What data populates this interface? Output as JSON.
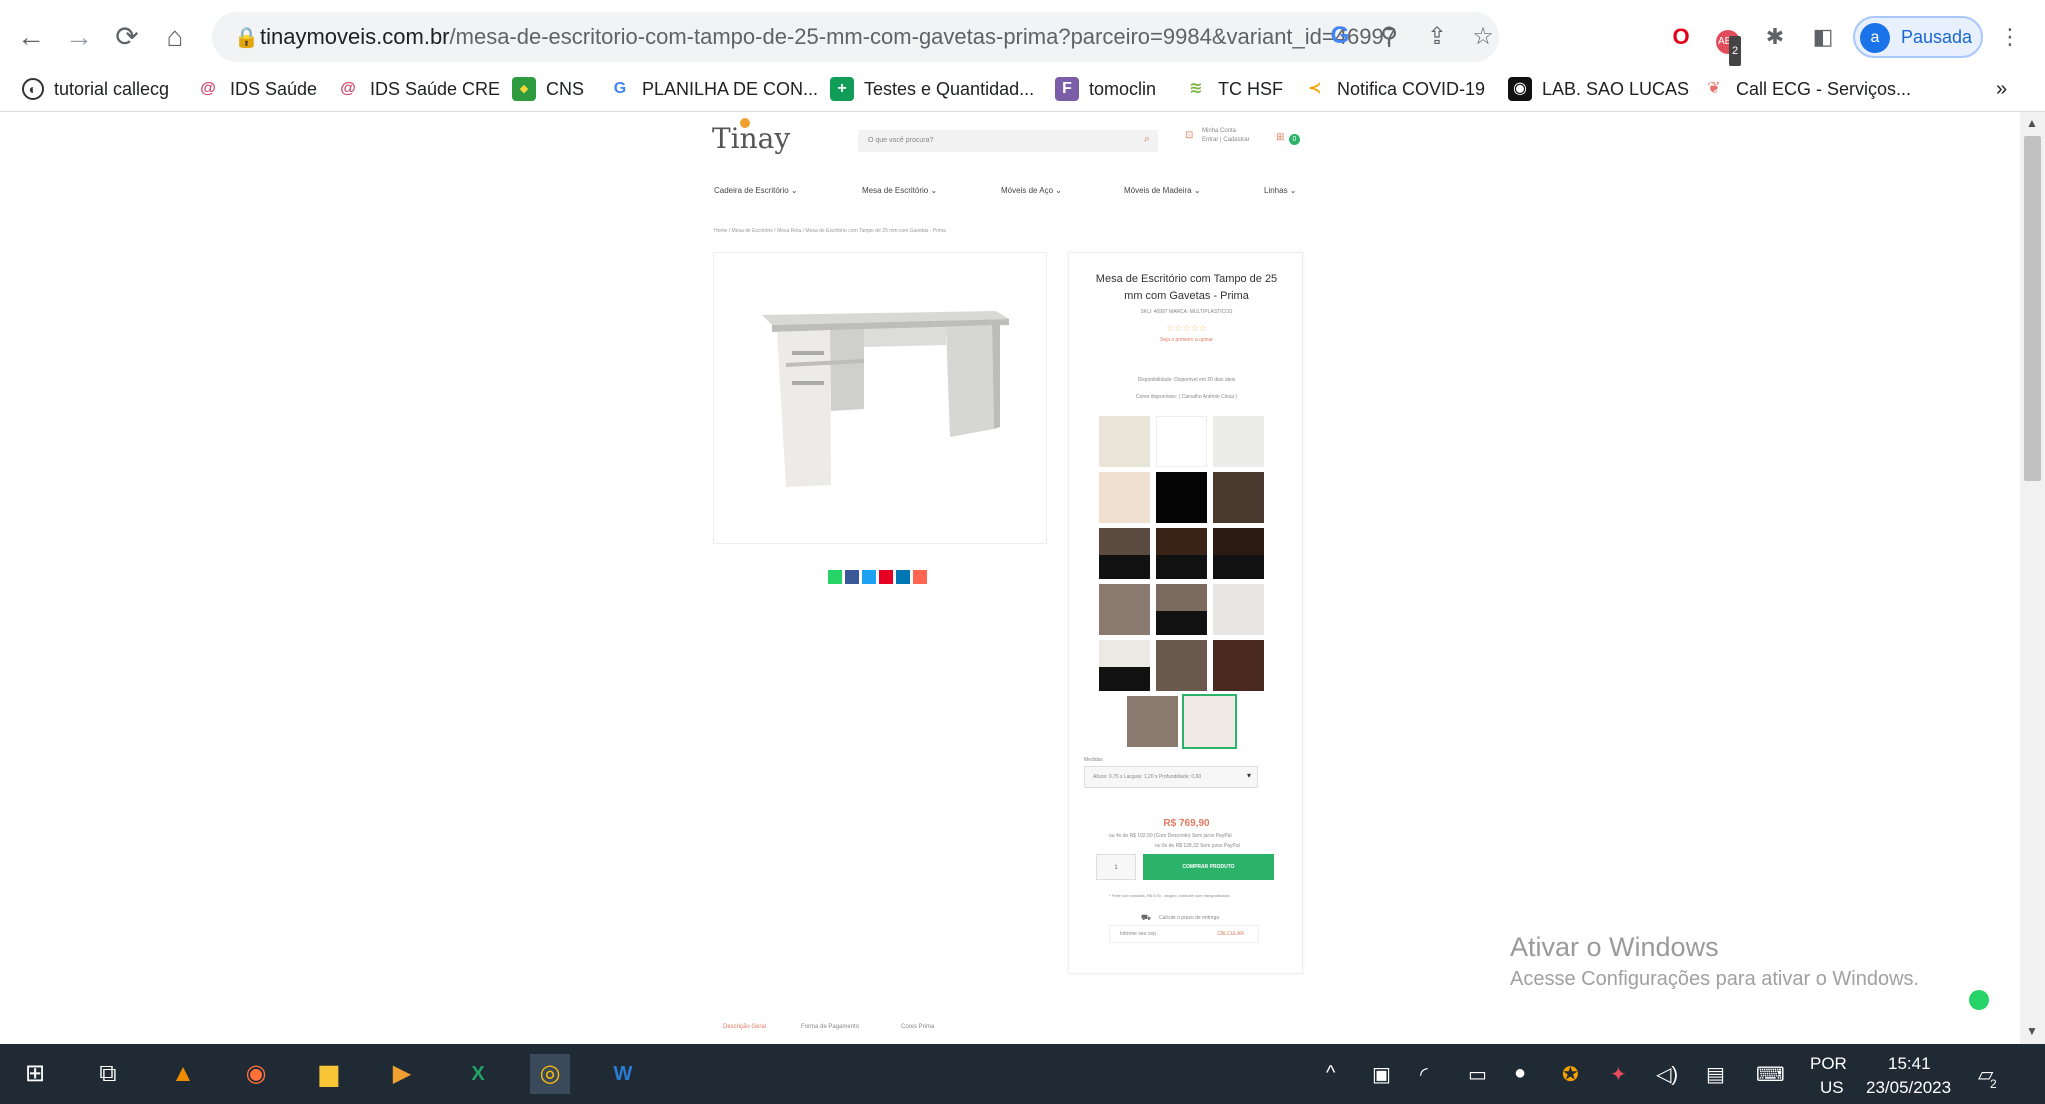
{
  "browser": {
    "url_host": "tinaymoveis.com.br",
    "url_path": "/mesa-de-escritorio-com-tampo-de-25-mm-com-gavetas-prima?parceiro=9984&variant_id=46997",
    "profile_initial": "a",
    "profile_label": "Pausada",
    "ext_badge": "2",
    "bookmarks": [
      {
        "label": "tutorial callecg",
        "icon": "globe-icon"
      },
      {
        "label": "IDS Saúde",
        "icon": "ids-icon"
      },
      {
        "label": "IDS Saúde CRE",
        "icon": "ids-icon"
      },
      {
        "label": "CNS",
        "icon": "cns-icon"
      },
      {
        "label": "PLANILHA DE CON...",
        "icon": "google-icon"
      },
      {
        "label": "Testes e Quantidad...",
        "icon": "plus-green-icon"
      },
      {
        "label": "tomoclin",
        "icon": "f-purple-icon"
      },
      {
        "label": "TC HSF",
        "icon": "tc-icon"
      },
      {
        "label": "Notifica COVID-19",
        "icon": "notifica-icon"
      },
      {
        "label": "LAB. SAO LUCAS",
        "icon": "lab-icon"
      },
      {
        "label": "Call ECG - Serviços...",
        "icon": "ecg-icon"
      }
    ],
    "more_bookmarks": "»"
  },
  "site": {
    "logo": "Tinay",
    "search_placeholder": "O que você procura?",
    "account_label": "Minha Conta",
    "account_sub": "Entrar | Cadastrar",
    "cart_count": "0",
    "nav": [
      "Cadeira de Escritório",
      "Mesa de Escritório",
      "Móveis de Aço",
      "Móveis de Madeira",
      "Linhas"
    ],
    "breadcrumb": "Home / Mesa de Escritório / Mesa Reta / Mesa de Escritório com Tampo de 25 mm com Gavetas - Prima",
    "product": {
      "title_line1": "Mesa de Escritório com Tampo de 25",
      "title_line2": "mm com Gavetas - Prima",
      "sku": "SKU: 46997   MARCA: MULTIPLASTICOS",
      "rating_text": "Seja o primeiro a opinar",
      "availability": "Disponibilidade: Disponível em 20 dias úteis",
      "colors_label": "Cores disponíveis: ( Carvalho Anêmio Cinza )",
      "measures_label": "Medidas",
      "measures_value": "Altura: 0,75 x Largura: 1,20 x Profundidade: 0,60",
      "price": "R$ 769,90",
      "installments_1": "ou 4x de R$ 192,50 (Com Desconto) Sem juros PayPal",
      "installments_2": "ou 6x de R$ 128,32 Sem juros PayPal",
      "qty": "1",
      "buy_label": "COMPRAR PRODUTO",
      "shipping_note": "* Frete sob consulta, R$ 0,00 - seguro, consulte com transportadora",
      "cep_label": "Calcule o prazo de entrega",
      "cep_placeholder": "Informe seu cep",
      "cep_button": "CALCULAR"
    },
    "tabs": [
      "Descrição Geral",
      "Forma de Pagamento",
      "Cores Prima"
    ],
    "swatch_colors": [
      "#e8e4d8",
      "#ffffff",
      "#ecece9",
      "#efe0d0",
      "#050505",
      "#4a3a30",
      "#5a4a40",
      "#3a2418",
      "#2a1a12",
      "#8a7a70",
      "#7a6a60",
      "#e8e6e2",
      "#ece9e4",
      "#6a5a4e",
      "#4a2a20",
      "#8a7a70",
      "#efeae6"
    ]
  },
  "windows": {
    "watermark_title": "Ativar o Windows",
    "watermark_sub": "Acesse Configurações para ativar o Windows.",
    "lang_top": "POR",
    "lang_bottom": "US",
    "time": "15:41",
    "date": "23/05/2023",
    "notif_count": "2"
  }
}
